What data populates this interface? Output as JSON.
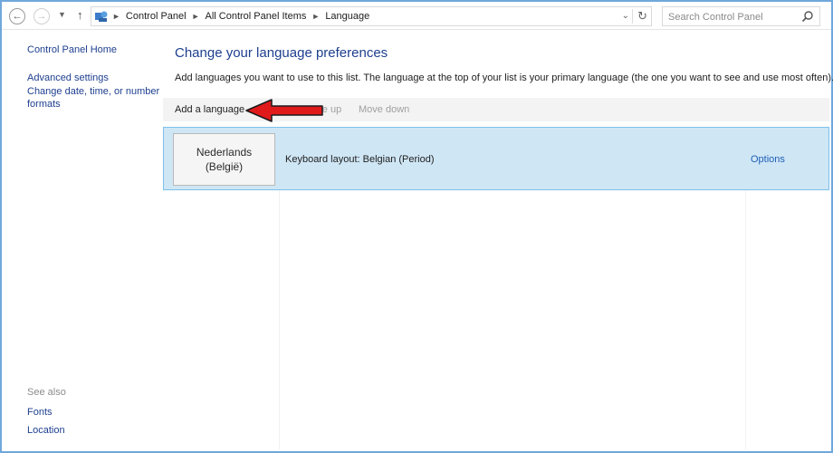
{
  "address_bar": {
    "breadcrumbs": [
      "Control Panel",
      "All Control Panel Items",
      "Language"
    ],
    "search_placeholder": "Search Control Panel"
  },
  "left_pane": {
    "home_link": "Control Panel Home",
    "links": [
      "Advanced settings",
      "Change date, time, or number formats"
    ],
    "see_also_label": "See also",
    "see_also_links": [
      "Fonts",
      "Location"
    ]
  },
  "main": {
    "title": "Change your language preferences",
    "description": "Add languages you want to use to this list. The language at the top of your list is your primary language (the one you want to see and use most often).",
    "toolbar": {
      "add_language": "Add a language",
      "move_up": "Move up",
      "move_down": "Move down"
    },
    "languages": [
      {
        "name_line1": "Nederlands",
        "name_line2": "(België)",
        "keyboard_layout": "Keyboard layout: Belgian (Period)",
        "options_label": "Options"
      }
    ]
  },
  "colors": {
    "link": "#1e3f8f",
    "selected_row": "#cfe6f5",
    "annotation_arrow": "#e0191b"
  }
}
